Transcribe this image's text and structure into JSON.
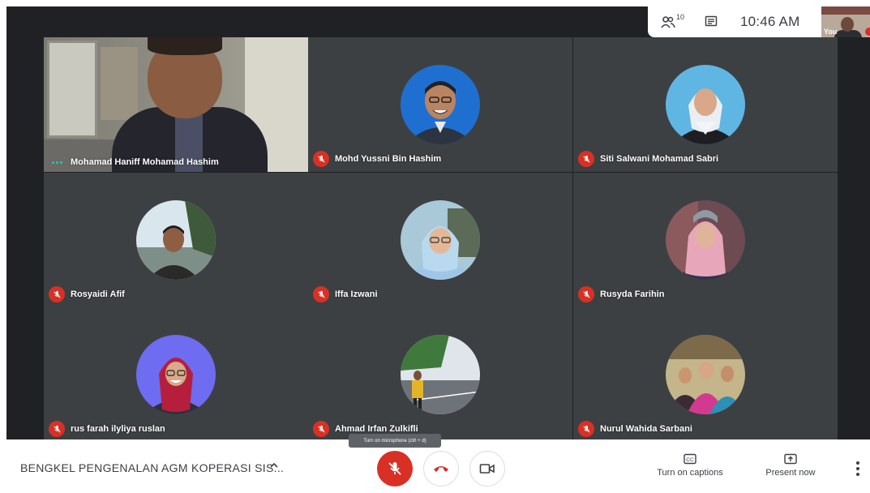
{
  "meeting": {
    "title": "BENGKEL PENGENALAN AGM KOPERASI SIS...",
    "time": "10:46 AM",
    "people_count": "10"
  },
  "self_view": {
    "label": "You"
  },
  "tooltip": "Turn on microphone (ctrl + d)",
  "controls": {
    "captions_label": "Turn on captions",
    "present_label": "Present now"
  },
  "participants": [
    {
      "name": "Mohamad Haniff Mohamad Hashim",
      "muted": false,
      "speaking": true
    },
    {
      "name": "Mohd Yussni Bin Hashim",
      "muted": true
    },
    {
      "name": "Siti Salwani Mohamad Sabri",
      "muted": true
    },
    {
      "name": "Rosyaidi Afif",
      "muted": true
    },
    {
      "name": "Iffa Izwani",
      "muted": true
    },
    {
      "name": "Rusyda Farihin",
      "muted": true
    },
    {
      "name": "rus farah ilyliya ruslan",
      "muted": true
    },
    {
      "name": "Ahmad Irfan Zulkifli",
      "muted": true
    },
    {
      "name": "Nurul Wahida Sarbani",
      "muted": true
    }
  ],
  "colors": {
    "stage_bg": "#202124",
    "tile_bg": "#3c4043",
    "muted_red": "#d93025",
    "speaking_teal": "#34c2a5",
    "icon_gray": "#3c4043"
  }
}
